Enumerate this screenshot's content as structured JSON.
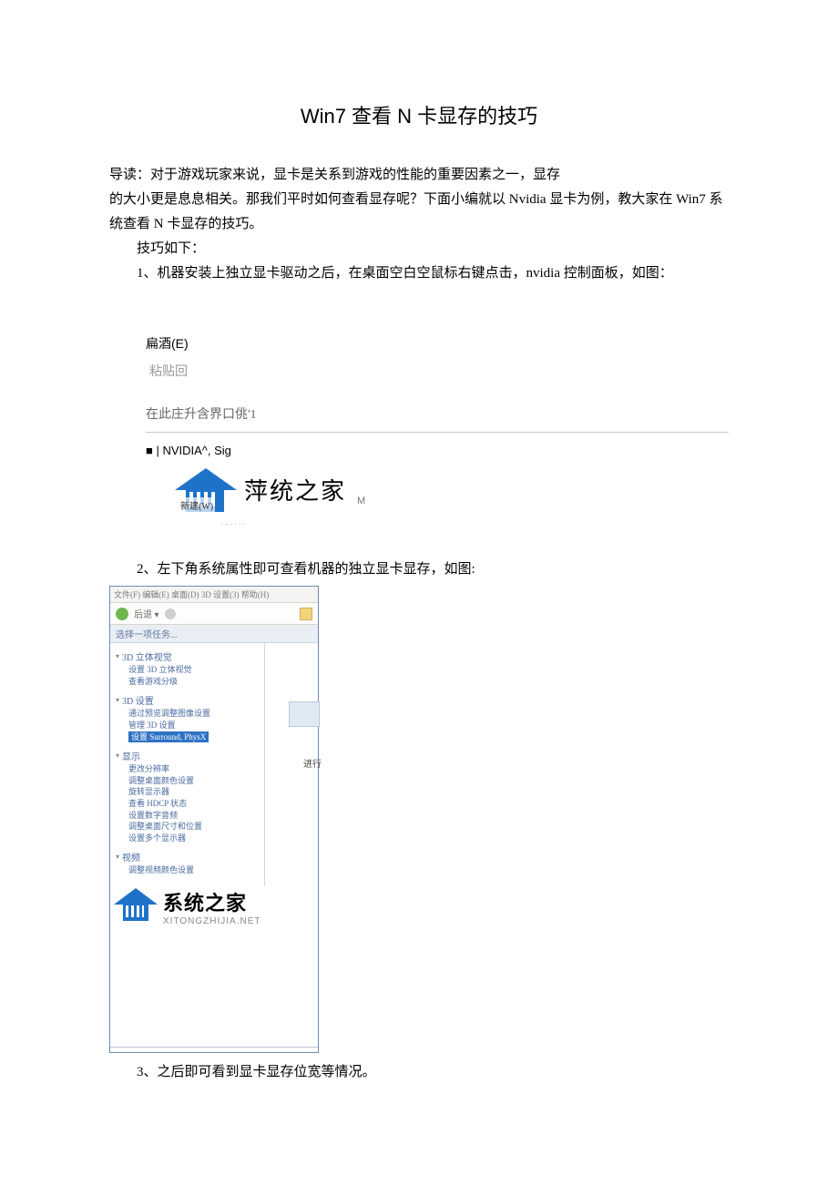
{
  "title": "Win7 查看 N 卡显存的技巧",
  "lead_line1": "导读：对于游戏玩家来说，显卡是关系到游戏的性能的重要因素之一，显存",
  "lead_line2": "的大小更是息息相关。那我们平时如何查看显存呢？下面小编就以 Nvidia 显卡为例，教大家在 Win7 系统查看 N 卡显存的技巧。",
  "tips_label": "技巧如下：",
  "step1": "1、机器安装上独立显卡驱动之后，在桌面空白空鼠标右键点击，nvidia 控制面板，如图：",
  "context_menu": {
    "item1": "扁酒(E)",
    "item2": "粘贴回",
    "item3": "在此庄升含界口佻'1",
    "nvidia_line": "■ | NVIDIA^, Sig",
    "new_label": "新建(W)",
    "logo_text": "萍统之家",
    "logo_sub": "M",
    "tiny": ". .. . . . ."
  },
  "step2": "2、左下角系统属性即可查看机器的独立显卡显存，如图:",
  "shot2": {
    "titlebar": "文件(F)  编辑(E)  桌面(D)  3D 设置(3)  帮助(H)",
    "toolbar_text": "后退 ▾",
    "crumb": "选择一项任务...",
    "right_label": "进行",
    "group1": {
      "head": "3D 立体视觉",
      "items": [
        "设置 3D 立体视觉",
        "查看游戏分级"
      ]
    },
    "group2": {
      "head": "3D 设置",
      "items": [
        "通过预览调整图像设置",
        "管理 3D 设置"
      ],
      "selected": "设置 Surround, PhysX"
    },
    "group3": {
      "head": "显示",
      "items": [
        "更改分辨率",
        "调整桌面颜色设置",
        "旋转显示器",
        "查看 HDCP 状态",
        "设置数字音频",
        "调整桌面尺寸和位置",
        "设置多个显示器"
      ]
    },
    "group4": {
      "head": "视频",
      "items": [
        "调整视频颜色设置"
      ]
    },
    "logo_text": "系统之家",
    "logo_sub": "XITONGZHIJIA.NET"
  },
  "step3": "3、之后即可看到显卡显存位宽等情况。"
}
